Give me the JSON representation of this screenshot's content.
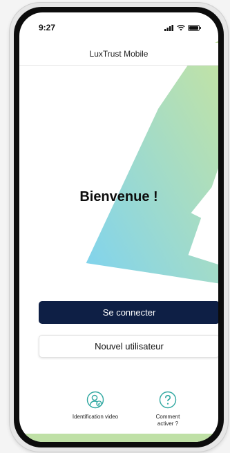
{
  "status_bar": {
    "time": "9:27",
    "icons": [
      "signal-icon",
      "wifi-icon",
      "battery-icon"
    ]
  },
  "header": {
    "title": "LuxTrust Mobile"
  },
  "main": {
    "welcome_text": "Bienvenue !",
    "login_button": "Se connecter",
    "new_user_button": "Nouvel utilisateur"
  },
  "shortcuts": {
    "video_identification": {
      "icon": "user-check-icon",
      "label": "Identification video"
    },
    "how_to_activate": {
      "icon": "question-circle-icon",
      "label_line1": "Comment",
      "label_line2": "activer ?"
    }
  },
  "colors": {
    "primary_button": "#0e1f45",
    "accent_teal": "#2ea7a0",
    "gradient_blue": "#7fd3ef",
    "gradient_green": "#bfe0a6"
  }
}
